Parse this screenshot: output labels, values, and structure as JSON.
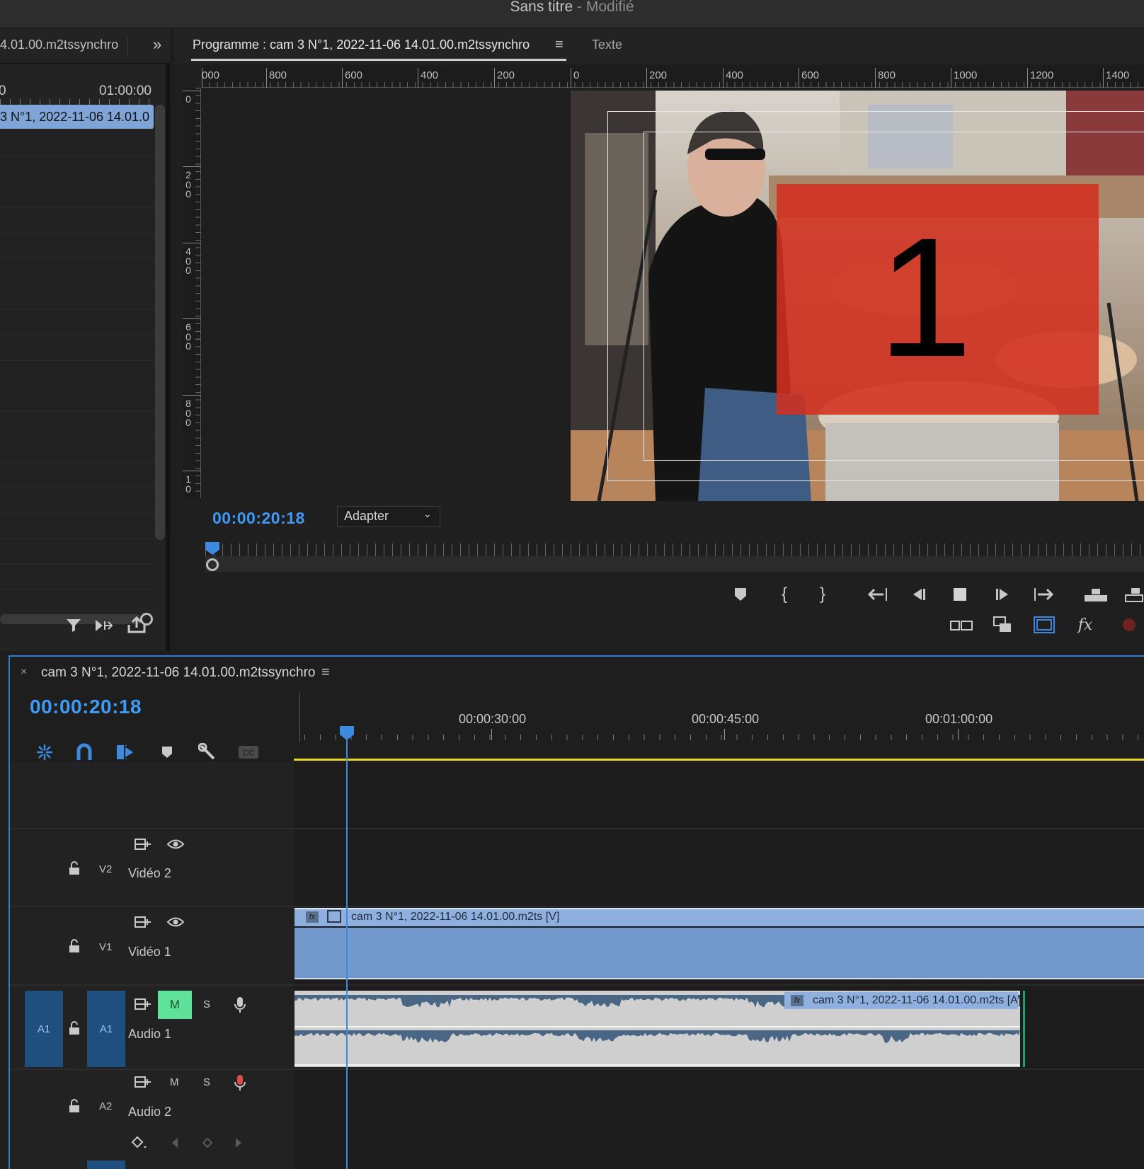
{
  "app": {
    "title": "Sans titre",
    "status": "- Modifié"
  },
  "left_panel": {
    "tab_label": "4.01.00.m2tssynchro",
    "more_icon": "double-chevron-right-icon",
    "ruler_start": "0",
    "ruler_end": "01:00:00",
    "clip_label": "3 N°1, 2022-11-06 14.01.0",
    "bottom_icons": [
      "filter-icon",
      "insert-clip-icon",
      "export-icon"
    ]
  },
  "program_monitor": {
    "tab_label": "Programme : cam 3 N°1, 2022-11-06 14.01.00.m2tssynchro",
    "menu_icon": "hamburger-icon",
    "text_tab": "Texte",
    "h_ruler": [
      "000",
      "800",
      "600",
      "400",
      "200",
      "0",
      "200",
      "400",
      "600",
      "800",
      "1000",
      "1200",
      "1400"
    ],
    "v_ruler": [
      "0",
      "200",
      "400",
      "600",
      "800",
      "10"
    ],
    "timecode": "00:00:20:18",
    "fit": "Adapter",
    "overlay_number": "1",
    "overlay_color": "#d3301f",
    "transport_row1": [
      "marker-icon",
      "mark-in-icon",
      "mark-out-icon",
      "go-to-in-icon",
      "step-back-icon",
      "stop-icon",
      "step-forward-icon",
      "go-to-out-icon",
      "lift-icon",
      "extract-icon"
    ],
    "transport_row2": [
      "compare-view-icon",
      "multi-camera-icon",
      "safe-margins-icon",
      "fx-icon",
      "record-icon"
    ]
  },
  "timeline": {
    "tab_label": "cam 3 N°1, 2022-11-06 14.01.00.m2tssynchro",
    "close_label": "×",
    "timecode": "00:00:20:18",
    "tools": [
      "nest-icon",
      "snap-magnet-icon",
      "linked-selection-icon",
      "add-marker-icon",
      "settings-wrench-icon",
      "captions-icon"
    ],
    "ruler": [
      "00:00:30:00",
      "00:00:45:00",
      "00:01:00:00"
    ],
    "tracks": {
      "v2": {
        "id": "V2",
        "name": "Vidéo 2"
      },
      "v1": {
        "id": "V1",
        "name": "Vidéo 1"
      },
      "a1": {
        "id": "A1",
        "name": "Audio 1",
        "source_patch": "A1",
        "mute": "M",
        "solo": "S"
      },
      "a2": {
        "id": "A2",
        "name": "Audio 2",
        "mute": "M",
        "solo": "S"
      }
    },
    "v1_clip": "cam 3 N°1, 2022-11-06 14.01.00.m2ts [V]",
    "a1_clip": "cam 3 N°1, 2022-11-06 14.01.00.m2ts [A]",
    "fx_label": "fx"
  }
}
